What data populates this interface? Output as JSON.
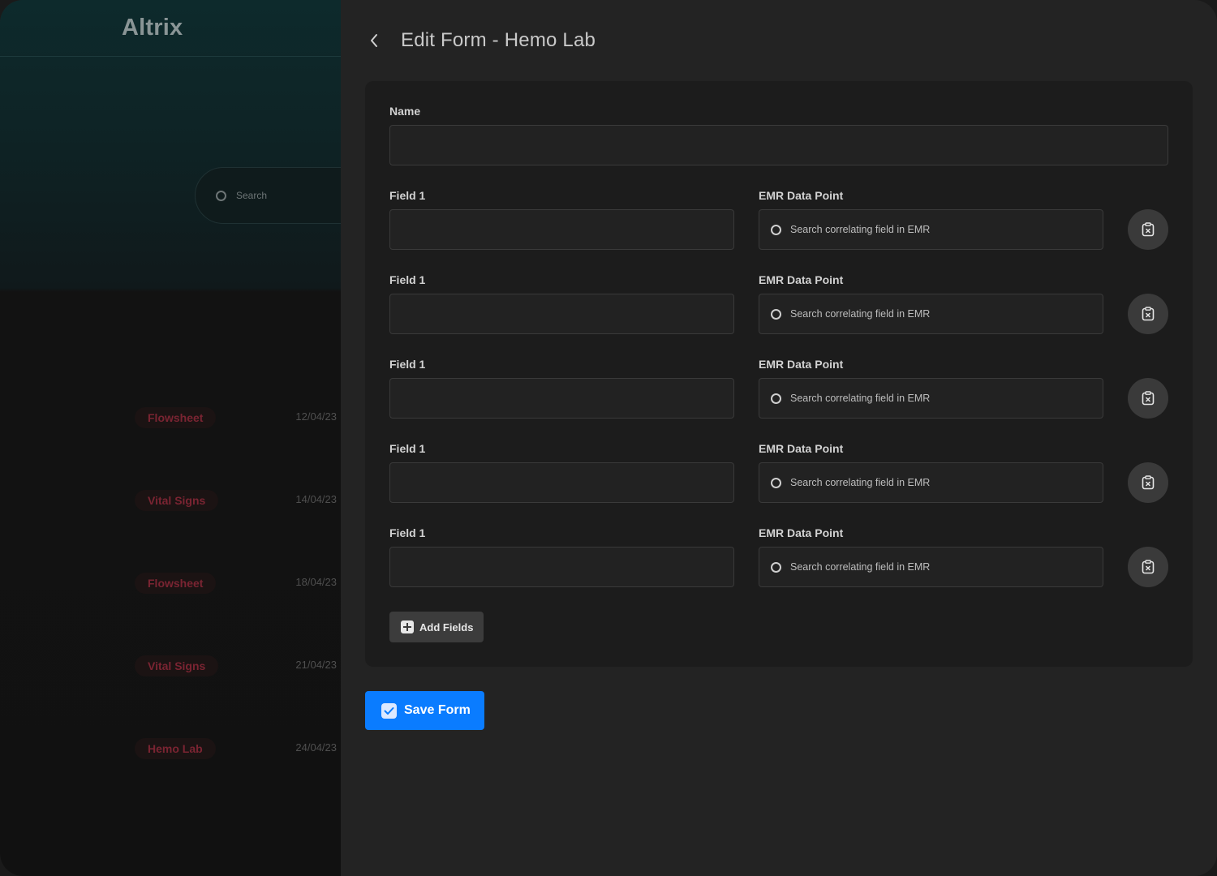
{
  "background_app": {
    "logo": "Altrix",
    "search_placeholder": "Search",
    "rows": [
      {
        "tag": "Flowsheet",
        "date": "12/04/23"
      },
      {
        "tag": "Vital Signs",
        "date": "14/04/23"
      },
      {
        "tag": "Flowsheet",
        "date": "18/04/23"
      },
      {
        "tag": "Vital Signs",
        "date": "21/04/23"
      },
      {
        "tag": "Hemo Lab",
        "date": "24/04/23"
      }
    ]
  },
  "panel": {
    "title": "Edit Form - Hemo Lab",
    "name_label": "Name",
    "name_value": "",
    "fields": [
      {
        "label": "Field 1",
        "value": "",
        "emr_label": "EMR Data Point",
        "emr_placeholder": "Search correlating field in EMR"
      },
      {
        "label": "Field 1",
        "value": "",
        "emr_label": "EMR Data Point",
        "emr_placeholder": "Search correlating field in EMR"
      },
      {
        "label": "Field 1",
        "value": "",
        "emr_label": "EMR Data Point",
        "emr_placeholder": "Search correlating field in EMR"
      },
      {
        "label": "Field 1",
        "value": "",
        "emr_label": "EMR Data Point",
        "emr_placeholder": "Search correlating field in EMR"
      },
      {
        "label": "Field 1",
        "value": "",
        "emr_label": "EMR Data Point",
        "emr_placeholder": "Search correlating field in EMR"
      }
    ],
    "add_fields_label": "Add Fields",
    "save_label": "Save Form"
  },
  "icons": {
    "back": "chevron-left-icon",
    "search": "search-icon",
    "delete": "clipboard-x-icon",
    "add": "plus-square-icon",
    "save": "check-square-icon"
  },
  "colors": {
    "accent": "#0a7cff",
    "tag_text": "#7a2432",
    "panel_bg": "#232323",
    "card_bg": "#1c1c1c"
  }
}
